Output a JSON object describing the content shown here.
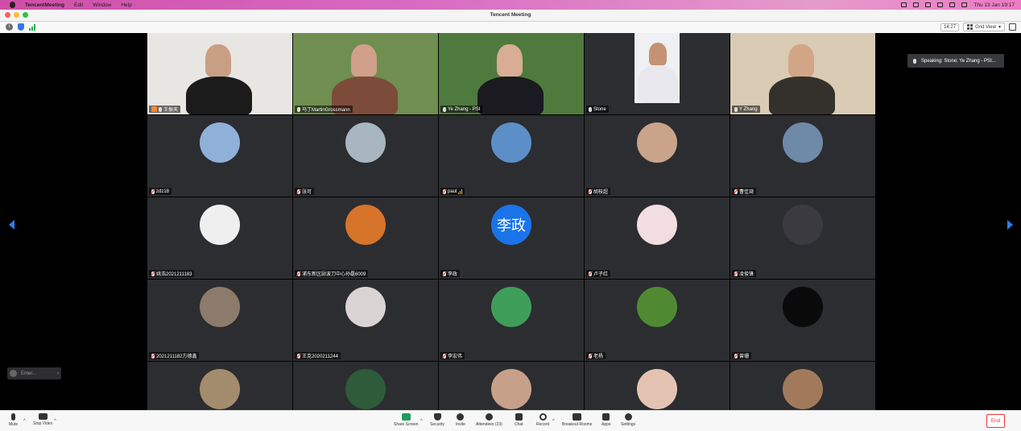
{
  "menubar": {
    "app": "TencentMeeting",
    "items": [
      "Edit",
      "Window",
      "Help"
    ],
    "datetime": "Thu 13 Jan  19:17"
  },
  "window": {
    "title": "Tencent Meeting"
  },
  "toolbar": {
    "elapsed": "14:27",
    "view_label": "Grid View"
  },
  "speaking": "Speaking: Stone; Ye Zhang - PSI...",
  "minichat": {
    "placeholder": "Enter..."
  },
  "participants": [
    {
      "name": "王振天",
      "video": true,
      "host": true,
      "bg": "#e8e6e3",
      "shirt": "#1b1b1b",
      "skin": "#c99f83"
    },
    {
      "name": "马丁MartinGrossmann",
      "video": true,
      "bg": "#6f8e4f",
      "shirt": "#7d4b39",
      "skin": "#d0a088"
    },
    {
      "name": "Ye Zhang - PSI",
      "video": true,
      "bg": "#4e7a3e",
      "shirt": "#1a1a20",
      "skin": "#d8ad93"
    },
    {
      "name": "Stone",
      "video": true,
      "active": true,
      "bg": "#2c2d30",
      "shirt": "#e8e8ee",
      "skin": "#c49374"
    },
    {
      "name": "Y Zhang",
      "video": true,
      "bg": "#d9cbb4",
      "shirt": "#34312d",
      "skin": "#d3a587"
    },
    {
      "name": "zdz18",
      "avatar_color": "#8fb0d8"
    },
    {
      "name": "张可",
      "avatar_color": "#a7b6bf"
    },
    {
      "name": "paul",
      "avatar_color": "#5c8fc8",
      "signal": true
    },
    {
      "name": "胡枝超",
      "avatar_color": "#c9a48a"
    },
    {
      "name": "曹佳琦",
      "avatar_color": "#6e8aa8"
    },
    {
      "name": "姚浩2021211183",
      "avatar_color": "#efefef"
    },
    {
      "name": "浦东新区尉波刀中心孙磊6009",
      "avatar_color": "#d6742a"
    },
    {
      "name": "李政",
      "avatar_text": "李政",
      "avatar_color": "#1a73e8"
    },
    {
      "name": "卢子红",
      "avatar_color": "#f2dde0"
    },
    {
      "name": "凌俊锋",
      "avatar_color": "#3a3a40"
    },
    {
      "name": "2021211182方德鑫",
      "avatar_color": "#8c7b6a"
    },
    {
      "name": "王克2020211244",
      "avatar_color": "#d9d3d3"
    },
    {
      "name": "李宏伟",
      "avatar_color": "#3f9d5a"
    },
    {
      "name": "老杨",
      "avatar_color": "#4f8a33"
    },
    {
      "name": "曾珊",
      "avatar_color": "#0a0a0a"
    },
    {
      "name": "",
      "avatar_color": "#a38c6e"
    },
    {
      "name": "",
      "avatar_color": "#2e5b3a"
    },
    {
      "name": "",
      "avatar_color": "#c7a08a"
    },
    {
      "name": "",
      "avatar_color": "#e4c3b3"
    },
    {
      "name": "",
      "avatar_color": "#a27a5b"
    }
  ],
  "bottombar": {
    "mute": "Mute",
    "stop_video": "Stop Video",
    "share_screen": "Share Screen",
    "security": "Security",
    "invite": "Invite",
    "attendees": "Attendees (23)",
    "chat": "Chat",
    "record": "Record",
    "breakout": "Breakout Rooms",
    "apps": "Apps",
    "settings": "Settings",
    "end": "End"
  }
}
